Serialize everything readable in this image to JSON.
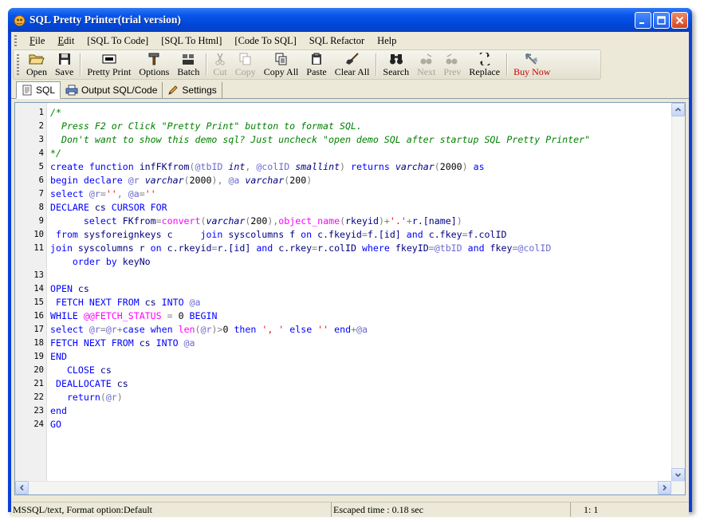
{
  "window": {
    "title": "SQL Pretty Printer(trial version)",
    "minimize": "_",
    "maximize": "□",
    "close": "×"
  },
  "menu": [
    {
      "label": "File",
      "hotkey": "F"
    },
    {
      "label": "Edit",
      "hotkey": "E"
    },
    {
      "label": "[SQL To Code]"
    },
    {
      "label": "[SQL To Html]"
    },
    {
      "label": "[Code To SQL]"
    },
    {
      "label": "SQL Refactor"
    },
    {
      "label": "Help"
    }
  ],
  "toolbar": [
    {
      "label": "Open",
      "icon": "folder-open-icon",
      "enabled": true
    },
    {
      "label": "Save",
      "icon": "floppy-disk-icon",
      "enabled": true
    },
    {
      "sep": true
    },
    {
      "label": "Pretty Print",
      "icon": "pretty-print-icon",
      "enabled": true
    },
    {
      "label": "Options",
      "icon": "hammer-icon",
      "enabled": true
    },
    {
      "label": "Batch",
      "icon": "batch-icon",
      "enabled": true
    },
    {
      "sep": true
    },
    {
      "label": "Cut",
      "icon": "scissors-icon",
      "enabled": false
    },
    {
      "label": "Copy",
      "icon": "copy-icon",
      "enabled": false
    },
    {
      "label": "Copy All",
      "icon": "copy-all-icon",
      "enabled": true
    },
    {
      "label": "Paste",
      "icon": "clipboard-icon",
      "enabled": true
    },
    {
      "label": "Clear All",
      "icon": "broom-icon",
      "enabled": true
    },
    {
      "sep": true
    },
    {
      "label": "Search",
      "icon": "binoculars-icon",
      "enabled": true
    },
    {
      "label": "Next",
      "icon": "find-next-icon",
      "enabled": false
    },
    {
      "label": "Prev",
      "icon": "find-prev-icon",
      "enabled": false
    },
    {
      "label": "Replace",
      "icon": "replace-icon",
      "enabled": true
    },
    {
      "sep": true
    },
    {
      "label": "Buy Now",
      "icon": "buy-now-icon",
      "enabled": true,
      "accent": "#cc0000"
    }
  ],
  "tabs": [
    {
      "label": "SQL",
      "icon": "document-icon",
      "active": true
    },
    {
      "label": "Output SQL/Code",
      "icon": "printer-icon",
      "active": false
    },
    {
      "label": "Settings",
      "icon": "pencil-icon",
      "active": false
    }
  ],
  "editor": {
    "lines": [
      {
        "n": "1",
        "tokens": [
          [
            "com",
            "/*"
          ]
        ]
      },
      {
        "n": "2",
        "tokens": [
          [
            "com",
            "  Press F2 or Click \"Pretty Print\" button to format SQL."
          ]
        ]
      },
      {
        "n": "3",
        "tokens": [
          [
            "com",
            "  Don't want to show this demo sql? Just uncheck \"open demo SQL after startup SQL Pretty Printer\""
          ]
        ]
      },
      {
        "n": "4",
        "tokens": [
          [
            "com",
            "*/"
          ]
        ]
      },
      {
        "n": "5",
        "tokens": [
          [
            "kw",
            "create"
          ],
          [
            "tx",
            " "
          ],
          [
            "kw",
            "function"
          ],
          [
            "tx",
            " infFKfrom"
          ],
          [
            "op",
            "("
          ],
          [
            "var",
            "@tbID"
          ],
          [
            "tx",
            " "
          ],
          [
            "it",
            "int"
          ],
          [
            "op",
            ","
          ],
          [
            "tx",
            " "
          ],
          [
            "var",
            "@colID"
          ],
          [
            "tx",
            " "
          ],
          [
            "it",
            "smallint"
          ],
          [
            "op",
            ")"
          ],
          [
            "tx",
            " "
          ],
          [
            "kw",
            "returns"
          ],
          [
            "tx",
            " "
          ],
          [
            "it",
            "varchar"
          ],
          [
            "op",
            "("
          ],
          [
            "num",
            "2000"
          ],
          [
            "op",
            ")"
          ],
          [
            "tx",
            " "
          ],
          [
            "kw",
            "as"
          ]
        ]
      },
      {
        "n": "6",
        "tokens": [
          [
            "kw",
            "begin"
          ],
          [
            "tx",
            " "
          ],
          [
            "kw",
            "declare"
          ],
          [
            "tx",
            " "
          ],
          [
            "var",
            "@r"
          ],
          [
            "tx",
            " "
          ],
          [
            "it",
            "varchar"
          ],
          [
            "op",
            "("
          ],
          [
            "num",
            "2000"
          ],
          [
            "op",
            "),"
          ],
          [
            "tx",
            " "
          ],
          [
            "var",
            "@a"
          ],
          [
            "tx",
            " "
          ],
          [
            "it",
            "varchar"
          ],
          [
            "op",
            "("
          ],
          [
            "num",
            "200"
          ],
          [
            "op",
            ")"
          ]
        ]
      },
      {
        "n": "7",
        "tokens": [
          [
            "kw",
            "select"
          ],
          [
            "tx",
            " "
          ],
          [
            "var",
            "@r"
          ],
          [
            "op",
            "="
          ],
          [
            "str",
            "''"
          ],
          [
            "op",
            ","
          ],
          [
            "tx",
            " "
          ],
          [
            "var",
            "@a"
          ],
          [
            "op",
            "="
          ],
          [
            "str",
            "''"
          ]
        ]
      },
      {
        "n": "8",
        "tokens": [
          [
            "kw",
            "DECLARE"
          ],
          [
            "tx",
            " cs "
          ],
          [
            "kw",
            "CURSOR"
          ],
          [
            "tx",
            " "
          ],
          [
            "kw",
            "FOR"
          ]
        ]
      },
      {
        "n": "9",
        "tokens": [
          [
            "tx",
            "      "
          ],
          [
            "kw",
            "select"
          ],
          [
            "tx",
            " FKfrom"
          ],
          [
            "op",
            "="
          ],
          [
            "fn",
            "convert"
          ],
          [
            "op",
            "("
          ],
          [
            "it",
            "varchar"
          ],
          [
            "op",
            "("
          ],
          [
            "num",
            "200"
          ],
          [
            "op",
            "),"
          ],
          [
            "fn",
            "object_name"
          ],
          [
            "op",
            "("
          ],
          [
            "tx",
            "rkeyid"
          ],
          [
            "op",
            ")+"
          ],
          [
            "str",
            "'.'"
          ],
          [
            "op",
            "+"
          ],
          [
            "tx",
            "r.[name]"
          ],
          [
            "op",
            ")"
          ]
        ]
      },
      {
        "n": "10",
        "tokens": [
          [
            "tx",
            " "
          ],
          [
            "kw",
            "from"
          ],
          [
            "tx",
            " sysforeignkeys c     "
          ],
          [
            "kw",
            "join"
          ],
          [
            "tx",
            " syscolumns f "
          ],
          [
            "kw",
            "on"
          ],
          [
            "tx",
            " c.fkeyid"
          ],
          [
            "op",
            "="
          ],
          [
            "tx",
            "f.[id] "
          ],
          [
            "kw",
            "and"
          ],
          [
            "tx",
            " c.fkey"
          ],
          [
            "op",
            "="
          ],
          [
            "tx",
            "f.colID"
          ]
        ]
      },
      {
        "n": "11",
        "tokens": [
          [
            "kw",
            "join"
          ],
          [
            "tx",
            " syscolumns r "
          ],
          [
            "kw",
            "on"
          ],
          [
            "tx",
            " c.rkeyid"
          ],
          [
            "op",
            "="
          ],
          [
            "tx",
            "r.[id] "
          ],
          [
            "kw",
            "and"
          ],
          [
            "tx",
            " c.rkey"
          ],
          [
            "op",
            "="
          ],
          [
            "tx",
            "r.colID "
          ],
          [
            "kw",
            "where"
          ],
          [
            "tx",
            " fkeyID"
          ],
          [
            "op",
            "="
          ],
          [
            "var",
            "@tbID"
          ],
          [
            "tx",
            " "
          ],
          [
            "kw",
            "and"
          ],
          [
            "tx",
            " fkey"
          ],
          [
            "op",
            "="
          ],
          [
            "var",
            "@colID"
          ]
        ]
      },
      {
        "n": "",
        "tokens": [
          [
            "tx",
            "    "
          ],
          [
            "kw",
            "order"
          ],
          [
            "tx",
            " "
          ],
          [
            "kw",
            "by"
          ],
          [
            "tx",
            " keyNo"
          ]
        ]
      },
      {
        "n": "13",
        "tokens": []
      },
      {
        "n": "14",
        "tokens": [
          [
            "kw",
            "OPEN"
          ],
          [
            "tx",
            " cs"
          ]
        ]
      },
      {
        "n": "15",
        "tokens": [
          [
            "tx",
            " "
          ],
          [
            "kw",
            "FETCH"
          ],
          [
            "tx",
            " "
          ],
          [
            "kw",
            "NEXT"
          ],
          [
            "tx",
            " "
          ],
          [
            "kw",
            "FROM"
          ],
          [
            "tx",
            " cs "
          ],
          [
            "kw",
            "INTO"
          ],
          [
            "tx",
            " "
          ],
          [
            "var",
            "@a"
          ]
        ]
      },
      {
        "n": "16",
        "tokens": [
          [
            "kw",
            "WHILE"
          ],
          [
            "tx",
            " "
          ],
          [
            "fn",
            "@@FETCH_STATUS"
          ],
          [
            "tx",
            " "
          ],
          [
            "op",
            "="
          ],
          [
            "tx",
            " "
          ],
          [
            "num",
            "0"
          ],
          [
            "tx",
            " "
          ],
          [
            "kw",
            "BEGIN"
          ]
        ]
      },
      {
        "n": "17",
        "tokens": [
          [
            "kw",
            "select"
          ],
          [
            "tx",
            " "
          ],
          [
            "var",
            "@r"
          ],
          [
            "op",
            "="
          ],
          [
            "var",
            "@r"
          ],
          [
            "op",
            "+"
          ],
          [
            "kw",
            "case"
          ],
          [
            "tx",
            " "
          ],
          [
            "kw",
            "when"
          ],
          [
            "tx",
            " "
          ],
          [
            "fn",
            "len"
          ],
          [
            "op",
            "("
          ],
          [
            "var",
            "@r"
          ],
          [
            "op",
            ")>"
          ],
          [
            "num",
            "0"
          ],
          [
            "tx",
            " "
          ],
          [
            "kw",
            "then"
          ],
          [
            "tx",
            " "
          ],
          [
            "str",
            "', '"
          ],
          [
            "tx",
            " "
          ],
          [
            "kw",
            "else"
          ],
          [
            "tx",
            " "
          ],
          [
            "str",
            "''"
          ],
          [
            "tx",
            " "
          ],
          [
            "kw",
            "end"
          ],
          [
            "op",
            "+"
          ],
          [
            "var",
            "@a"
          ]
        ]
      },
      {
        "n": "18",
        "tokens": [
          [
            "kw",
            "FETCH"
          ],
          [
            "tx",
            " "
          ],
          [
            "kw",
            "NEXT"
          ],
          [
            "tx",
            " "
          ],
          [
            "kw",
            "FROM"
          ],
          [
            "tx",
            " cs "
          ],
          [
            "kw",
            "INTO"
          ],
          [
            "tx",
            " "
          ],
          [
            "var",
            "@a"
          ]
        ]
      },
      {
        "n": "19",
        "tokens": [
          [
            "kw",
            "END"
          ]
        ]
      },
      {
        "n": "20",
        "tokens": [
          [
            "tx",
            "   "
          ],
          [
            "kw",
            "CLOSE"
          ],
          [
            "tx",
            " cs"
          ]
        ]
      },
      {
        "n": "21",
        "tokens": [
          [
            "tx",
            " "
          ],
          [
            "kw",
            "DEALLOCATE"
          ],
          [
            "tx",
            " cs"
          ]
        ]
      },
      {
        "n": "22",
        "tokens": [
          [
            "tx",
            "   "
          ],
          [
            "kw",
            "return"
          ],
          [
            "op",
            "("
          ],
          [
            "var",
            "@r"
          ],
          [
            "op",
            ")"
          ]
        ]
      },
      {
        "n": "23",
        "tokens": [
          [
            "kw",
            "end"
          ]
        ]
      },
      {
        "n": "24",
        "tokens": [
          [
            "kw",
            "GO"
          ]
        ]
      }
    ]
  },
  "status": {
    "mode": "MSSQL/text, Format option:Default",
    "elapsed": "Escaped time : 0.18 sec",
    "position": "1:  1"
  },
  "colors": {
    "keyword": "#0000ff",
    "comment": "#008000",
    "string": "#ff0000",
    "function": "#ff00ff",
    "variable": "#6b6bd0",
    "title_bar": "#0a56ea"
  }
}
